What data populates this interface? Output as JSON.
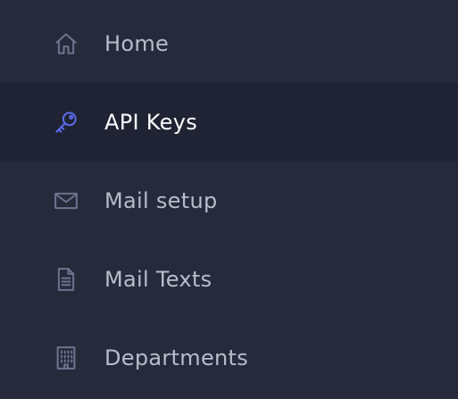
{
  "sidebar": {
    "items": [
      {
        "label": "Home",
        "icon": "home-icon",
        "active": false
      },
      {
        "label": "API Keys",
        "icon": "key-icon",
        "active": true
      },
      {
        "label": "Mail setup",
        "icon": "envelope-icon",
        "active": false
      },
      {
        "label": "Mail Texts",
        "icon": "document-icon",
        "active": false
      },
      {
        "label": "Departments",
        "icon": "building-icon",
        "active": false
      }
    ]
  },
  "colors": {
    "background": "#272a3a",
    "active_background": "#202333",
    "icon": "#6e7490",
    "active_icon": "#5b6cf0",
    "text": "#b9bccb",
    "active_text": "#ffffff"
  }
}
